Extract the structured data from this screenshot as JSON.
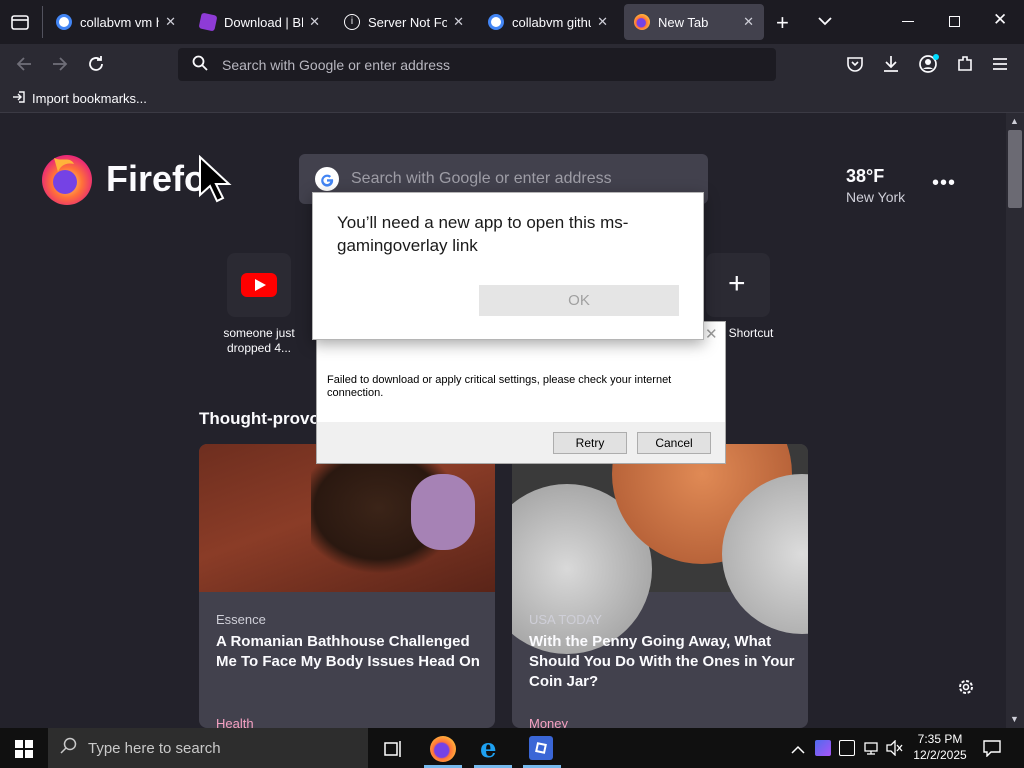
{
  "tabs": [
    {
      "label": "collabvm vm ha",
      "icon": "google-icon"
    },
    {
      "label": "Download | Blox",
      "icon": "bloxstrap-icon"
    },
    {
      "label": "Server Not Foun",
      "icon": "info-icon"
    },
    {
      "label": "collabvm github",
      "icon": "google-icon"
    },
    {
      "label": "New Tab",
      "icon": "firefox-icon"
    }
  ],
  "urlbar": {
    "placeholder": "Search with Google or enter address"
  },
  "bookmarks": {
    "import_label": "Import bookmarks..."
  },
  "newtab": {
    "brand": "Firefo",
    "search_placeholder": "Search with Google or enter address",
    "weather": {
      "temp": "38°F",
      "city": "New York"
    },
    "shortcuts": [
      {
        "label": "someone just dropped 4..."
      },
      {
        "label": "Shortcut"
      }
    ],
    "section_title": "Thought-provo",
    "cards": [
      {
        "source": "Essence",
        "title": "A Romanian Bathhouse Challenged Me To Face My Body Issues Head On",
        "category": "Health"
      },
      {
        "source": "USA TODAY",
        "title": "With the Penny Going Away, What Should You Do With the Ones in Your Coin Jar?",
        "category": "Money"
      }
    ]
  },
  "dialog_app": {
    "message": "You’ll need a new app to open this ms-gamingoverlay link",
    "ok_label": "OK"
  },
  "dialog_error": {
    "message": "Failed to download or apply critical settings, please check your internet connection.",
    "retry_label": "Retry",
    "cancel_label": "Cancel"
  },
  "taskbar": {
    "search_placeholder": "Type here to search",
    "time": "7:35 PM",
    "date": "12/2/2025"
  },
  "colors": {
    "accent": "#f5a1c1",
    "tab_active": "#42414d",
    "background": "#1c1b22"
  }
}
